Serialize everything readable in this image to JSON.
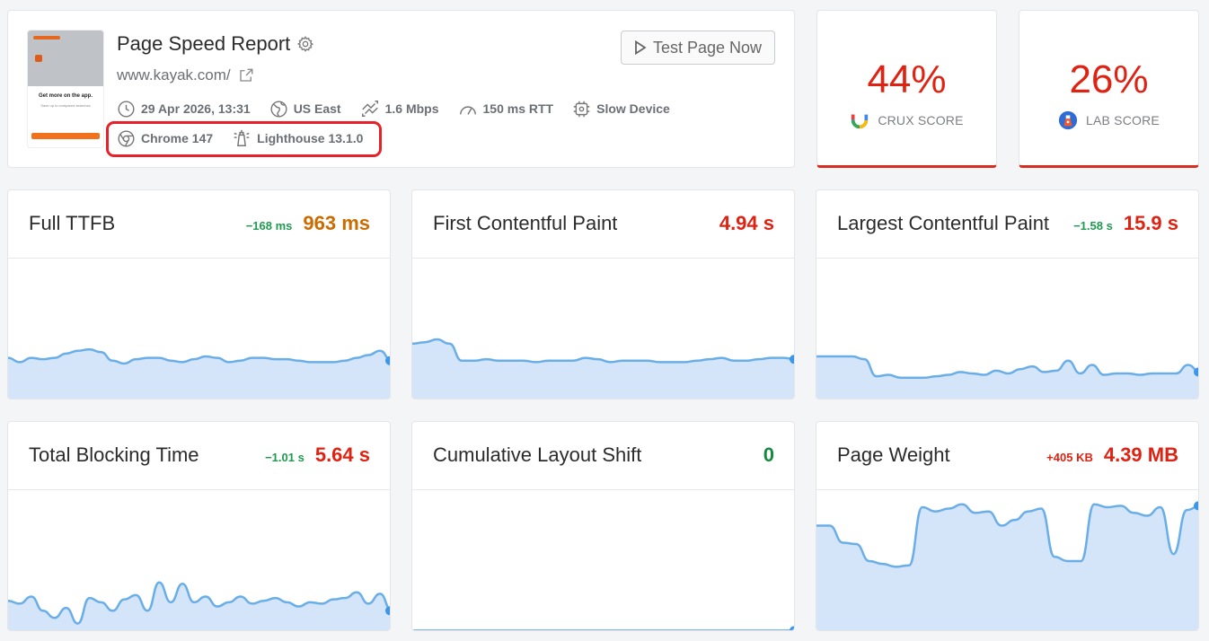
{
  "header": {
    "title": "Page Speed Report",
    "url": "www.kayak.com/",
    "thumbnail": {
      "headline": "Get more on the app.",
      "subline": "Save up to compared searches"
    },
    "test_button_label": "Test Page Now",
    "meta_row1": [
      {
        "icon": "clock-icon",
        "label": "29 Apr 2026, 13:31"
      },
      {
        "icon": "globe-icon",
        "label": "US East"
      },
      {
        "icon": "connection-speed-icon",
        "label": "1.6 Mbps"
      },
      {
        "icon": "latency-gauge-icon",
        "label": "150 ms RTT"
      },
      {
        "icon": "cpu-chip-icon",
        "label": "Slow Device"
      }
    ],
    "meta_row2": [
      {
        "icon": "chrome-icon",
        "label": "Chrome 147"
      },
      {
        "icon": "lighthouse-icon",
        "label": "Lighthouse 13.1.0"
      }
    ]
  },
  "scores": {
    "crux": {
      "value": "44%",
      "label": "CRUX SCORE",
      "color": "#df2212"
    },
    "lab": {
      "value": "26%",
      "label": "LAB SCORE",
      "color": "#df2212"
    }
  },
  "metrics": [
    {
      "name": "Full TTFB",
      "delta": "−168 ms",
      "delta_color": "green",
      "value": "963 ms",
      "value_color": "orange",
      "trend": [
        0.3,
        0.27,
        0.3,
        0.29,
        0.3,
        0.33,
        0.35,
        0.36,
        0.34,
        0.28,
        0.26,
        0.29,
        0.3,
        0.3,
        0.28,
        0.27,
        0.29,
        0.31,
        0.3,
        0.27,
        0.28,
        0.3,
        0.3,
        0.29,
        0.29,
        0.28,
        0.27,
        0.27,
        0.27,
        0.28,
        0.3,
        0.32,
        0.35,
        0.28
      ]
    },
    {
      "name": "First Contentful Paint",
      "delta": "",
      "delta_color": "green",
      "value": "4.94 s",
      "value_color": "red",
      "trend": [
        0.4,
        0.41,
        0.43,
        0.4,
        0.28,
        0.28,
        0.29,
        0.28,
        0.28,
        0.28,
        0.27,
        0.28,
        0.28,
        0.28,
        0.3,
        0.29,
        0.27,
        0.28,
        0.28,
        0.28,
        0.27,
        0.27,
        0.27,
        0.28,
        0.29,
        0.3,
        0.28,
        0.28,
        0.29,
        0.3,
        0.3,
        0.29
      ]
    },
    {
      "name": "Largest Contentful Paint",
      "delta": "−1.58 s",
      "delta_color": "green",
      "value": "15.9 s",
      "value_color": "red",
      "trend": [
        0.31,
        0.31,
        0.31,
        0.31,
        0.29,
        0.17,
        0.18,
        0.16,
        0.16,
        0.16,
        0.17,
        0.18,
        0.2,
        0.19,
        0.18,
        0.21,
        0.19,
        0.22,
        0.24,
        0.2,
        0.21,
        0.28,
        0.19,
        0.25,
        0.18,
        0.19,
        0.19,
        0.18,
        0.19,
        0.19,
        0.19,
        0.25,
        0.2
      ]
    },
    {
      "name": "Total Blocking Time",
      "delta": "−1.01 s",
      "delta_color": "green",
      "value": "5.64 s",
      "value_color": "red",
      "trend": [
        0.22,
        0.2,
        0.25,
        0.15,
        0.1,
        0.17,
        0.06,
        0.24,
        0.21,
        0.15,
        0.23,
        0.26,
        0.15,
        0.35,
        0.21,
        0.34,
        0.21,
        0.25,
        0.18,
        0.21,
        0.25,
        0.2,
        0.22,
        0.24,
        0.21,
        0.18,
        0.21,
        0.2,
        0.23,
        0.24,
        0.28,
        0.2,
        0.27,
        0.15
      ]
    },
    {
      "name": "Cumulative Layout Shift",
      "delta": "",
      "delta_color": "green",
      "value": "0",
      "value_color": "dgreen",
      "trend": [
        0.01,
        0.01,
        0.01,
        0.01,
        0.01,
        0.01,
        0.01,
        0.01,
        0.01,
        0.01,
        0.01,
        0.01
      ]
    },
    {
      "name": "Page Weight",
      "delta": "+405 KB",
      "delta_color": "red",
      "value": "4.39 MB",
      "value_color": "red",
      "trend": [
        0.75,
        0.75,
        0.63,
        0.62,
        0.5,
        0.48,
        0.46,
        0.47,
        0.88,
        0.85,
        0.87,
        0.9,
        0.84,
        0.85,
        0.75,
        0.79,
        0.85,
        0.87,
        0.53,
        0.5,
        0.5,
        0.9,
        0.88,
        0.89,
        0.84,
        0.82,
        0.88,
        0.55,
        0.86,
        0.89
      ]
    }
  ],
  "colors": {
    "spark_line": "#6aaee8",
    "spark_fill": "#d4e5f9",
    "highlight": "#e8202a"
  }
}
